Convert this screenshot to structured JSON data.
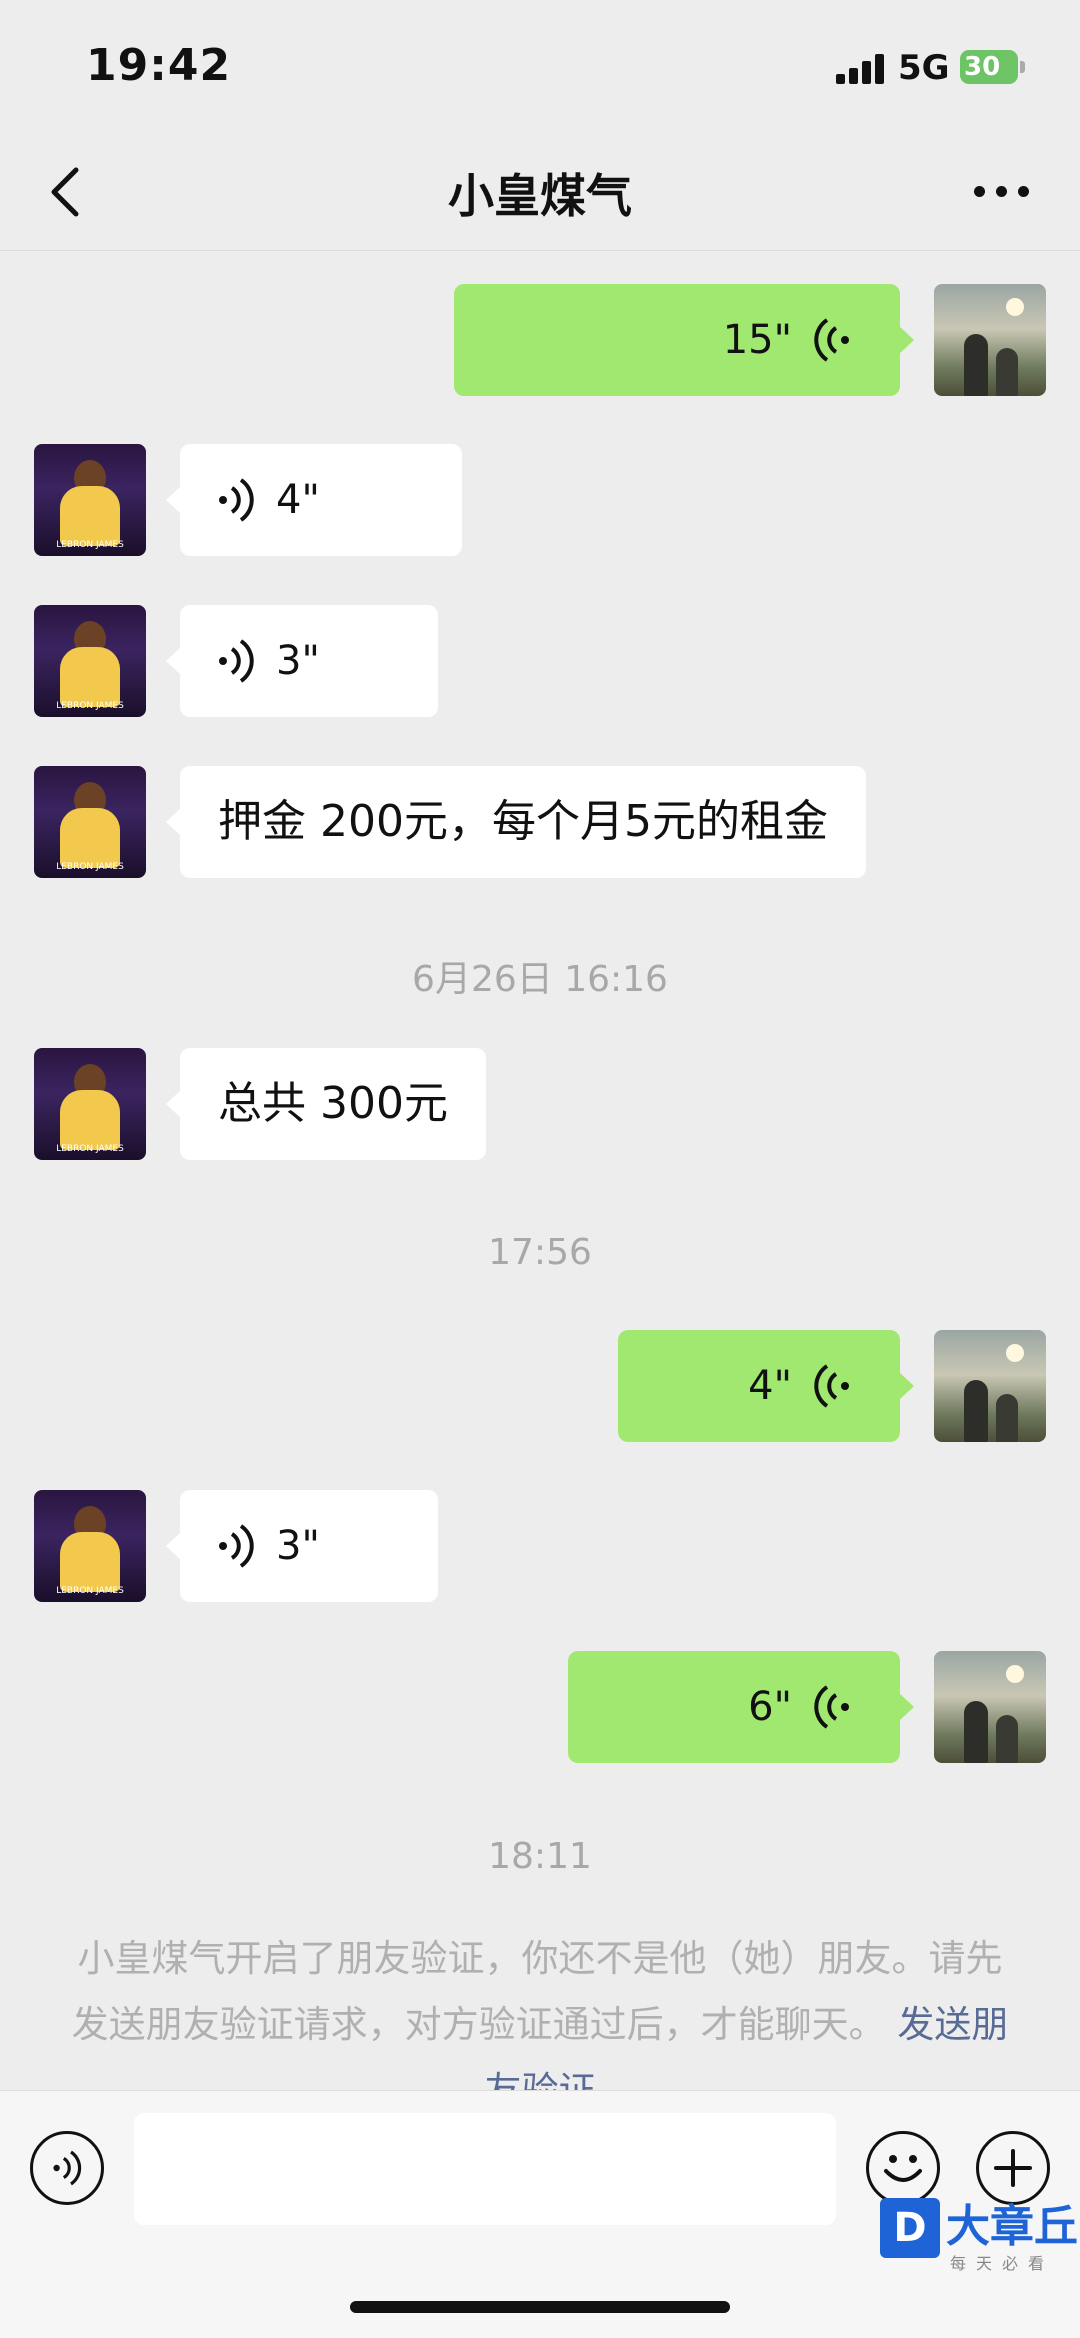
{
  "status_bar": {
    "time": "19:42",
    "network": "5G",
    "battery": "30"
  },
  "nav": {
    "title": "小皇煤气"
  },
  "messages": [
    {
      "side": "out",
      "type": "voice",
      "duration": "15\""
    },
    {
      "side": "in",
      "type": "voice",
      "duration": "4\""
    },
    {
      "side": "in",
      "type": "voice",
      "duration": "3\""
    },
    {
      "side": "in",
      "type": "text",
      "text": "押金 200元，每个月5元的租金"
    },
    {
      "type": "timestamp",
      "text": "6月26日 16:16"
    },
    {
      "side": "in",
      "type": "text",
      "text": "总共 300元"
    },
    {
      "type": "timestamp",
      "text": "17:56"
    },
    {
      "side": "out",
      "type": "voice",
      "duration": "4\""
    },
    {
      "side": "in",
      "type": "voice",
      "duration": "3\""
    },
    {
      "side": "out",
      "type": "voice",
      "duration": "6\""
    },
    {
      "type": "timestamp",
      "text": "18:11"
    }
  ],
  "system_notice": {
    "text": "小皇煤气开启了朋友验证，你还不是他（她）朋友。请先发送朋友验证请求，对方验证通过后，才能聊天。",
    "link": "发送朋友验证"
  },
  "avatars": {
    "contact_text": "LEBRON JAMES"
  },
  "watermark": {
    "logo": "D",
    "title": "大章丘",
    "subtitle": "每天必看"
  },
  "colors": {
    "outgoing_bubble": "#a0e870",
    "incoming_bubble": "#ffffff",
    "background": "#ededed",
    "link": "#576b95"
  }
}
